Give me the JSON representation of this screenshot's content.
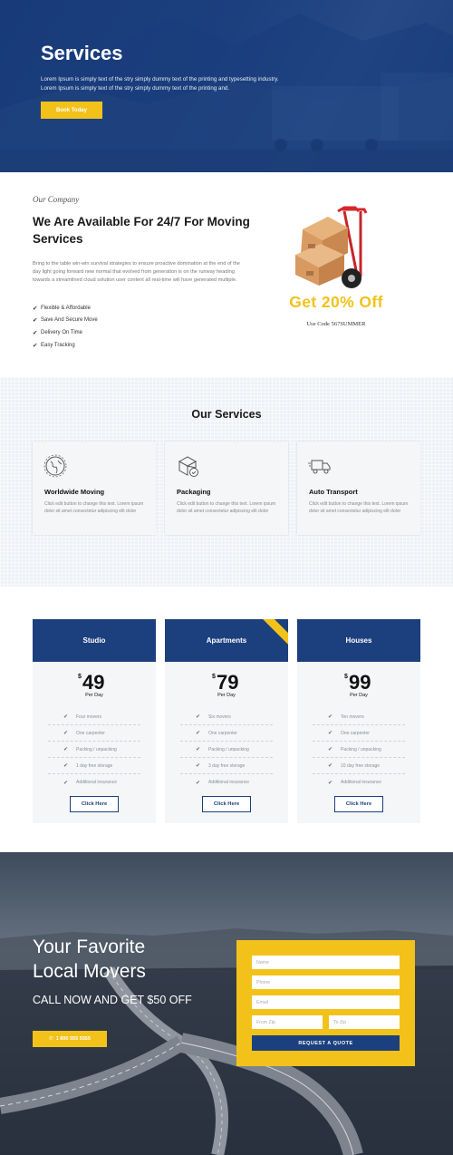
{
  "hero": {
    "title": "Services",
    "line1": "Lorem Ipsum is simply text of the stry simply dummy text of the printing and typesetting industry.",
    "line2": "Lorem Ipsum is simply text of the stry simply dummy text of the printing and.",
    "button": "Book Today"
  },
  "company": {
    "eyebrow": "Our Company",
    "title": "We Are Available For 24/7 For Moving Services",
    "paragraph": "Bring to the table win-win survival strategies to ensure proactive domination at the end of the day light going forward new normal that evolved from generation is on the runway heading towards a streamlined cloud solution user content all real-time will have generated multiple.",
    "features": [
      "Flexible & Affordable",
      "Save And Secure Move",
      "Delivery On Time",
      "Easy Tracking"
    ],
    "promo": "Get 20% Off",
    "promo_code": "Use Code 567SUMMER"
  },
  "services": {
    "title": "Our Services",
    "cards": [
      {
        "title": "Worldwide Moving",
        "desc": "Click edit button to change this text. Lorem ipsum dolor sit amet consectetur adipiscing elit dolor",
        "icon": "globe-icon"
      },
      {
        "title": "Packaging",
        "desc": "Click edit button to change this text. Lorem ipsum dolor sit amet consectetur adipiscing elit dolor",
        "icon": "box-icon"
      },
      {
        "title": "Auto Transport",
        "desc": "Click edit button to change this text. Lorem ipsum dolor sit amet consectetur adipiscing elit dolor",
        "icon": "truck-icon"
      }
    ]
  },
  "pricing": {
    "currency": "$",
    "per": "Per Day",
    "button": "Click Here",
    "plans": [
      {
        "name": "Studio",
        "price": "49",
        "features": [
          "Four movers",
          "One carpenter",
          "Packing / unpacking",
          "1 day free storage",
          "Additional insurance"
        ]
      },
      {
        "name": "Apartments",
        "price": "79",
        "features": [
          "Six movers",
          "One carpenter",
          "Packing / unpacking",
          "3 day free storage",
          "Additional insurance"
        ]
      },
      {
        "name": "Houses",
        "price": "99",
        "features": [
          "Ten movers",
          "One carpenter",
          "Packing / unpacking",
          "10 day free storage",
          "Additional insurance"
        ]
      }
    ]
  },
  "cta": {
    "title_line1": "Your Favorite",
    "title_line2": "Local Movers",
    "subtitle": "CALL NOW AND GET $50 OFF",
    "phone": "1 800 555 5555"
  },
  "quote_form": {
    "name_placeholder": "Name",
    "phone_placeholder": "Phone",
    "email_placeholder": "Email",
    "from_placeholder": "From Zip",
    "to_placeholder": "To Zip",
    "submit": "REQUEST A QUOTE"
  },
  "colors": {
    "brand_blue": "#1c3f7e",
    "accent_yellow": "#f2c21a"
  }
}
